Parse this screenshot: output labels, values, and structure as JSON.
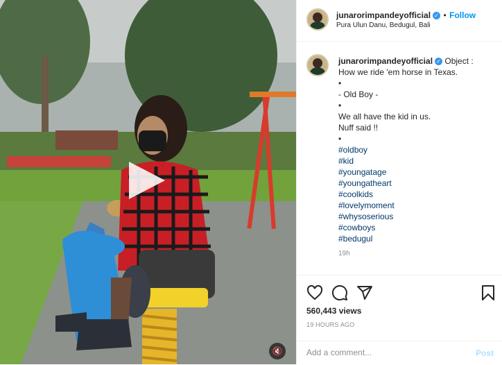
{
  "header": {
    "username": "junarorimpandeyofficial",
    "follow_label": "Follow",
    "location": "Pura Ulun Danu, Bedugul, Bali"
  },
  "caption": {
    "username": "junarorimpandeyofficial",
    "lines": [
      "Object :",
      "How we ride 'em horse in Texas.",
      "•",
      "- Old Boy -",
      "•",
      "We all have the kid in us.",
      "Nuff said !!",
      "•"
    ],
    "hashtags": [
      "#oldboy",
      "#kid",
      "#youngatage",
      "#youngatheart",
      "#coolkids",
      "#lovelymoment",
      "#whysoserious",
      "#cowboys",
      "#bedugul"
    ],
    "time_ago": "19h"
  },
  "stats": {
    "views": "560,443 views",
    "posted": "19 HOURS AGO"
  },
  "comment": {
    "placeholder": "Add a comment...",
    "post_label": "Post"
  },
  "colors": {
    "link": "#00376b",
    "follow": "#0095f6",
    "verified": "#3897f0"
  },
  "icons": [
    "play-icon",
    "mute-icon",
    "heart-icon",
    "comment-icon",
    "share-icon",
    "bookmark-icon",
    "verified-icon"
  ]
}
